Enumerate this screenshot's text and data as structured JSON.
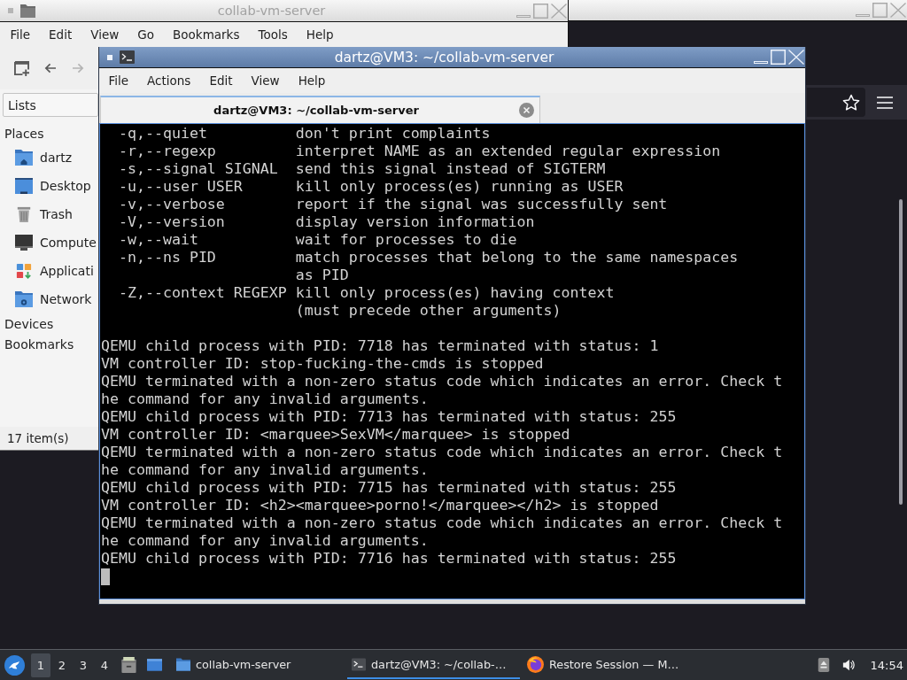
{
  "file_manager": {
    "active": false,
    "title": "collab-vm-server",
    "menu": [
      "File",
      "Edit",
      "View",
      "Go",
      "Bookmarks",
      "Tools",
      "Help"
    ],
    "toolbar": [
      {
        "kind": "new-tab",
        "disabled": false
      },
      {
        "kind": "back",
        "disabled": false
      },
      {
        "kind": "forward",
        "disabled": true
      }
    ],
    "sidebar": {
      "view": "Lists",
      "sections": [
        {
          "heading": "Places",
          "items": [
            {
              "kind": "home",
              "label": "dartz"
            },
            {
              "kind": "desktop",
              "label": "Desktop"
            },
            {
              "kind": "trash",
              "label": "Trash"
            },
            {
              "kind": "computer",
              "label": "Compute"
            },
            {
              "kind": "applications",
              "label": "Applicati"
            },
            {
              "kind": "network",
              "label": "Network"
            }
          ]
        },
        {
          "heading": "Devices"
        },
        {
          "heading": "Bookmarks"
        }
      ]
    },
    "status": "17 item(s)"
  },
  "terminal": {
    "active": true,
    "title": "dartz@VM3: ~/collab-vm-server",
    "menu": [
      "File",
      "Actions",
      "Edit",
      "View",
      "Help"
    ],
    "tabs": [
      {
        "label": "dartz@VM3: ~/collab-vm-server",
        "selected": true
      }
    ],
    "options": [
      {
        "flag": "-q,--quiet",
        "description": [
          "don't print complaints"
        ]
      },
      {
        "flag": "-r,--regexp",
        "description": [
          "interpret NAME as an extended regular expression"
        ]
      },
      {
        "flag": "-s,--signal SIGNAL",
        "description": [
          "send this signal instead of SIGTERM"
        ]
      },
      {
        "flag": "-u,--user USER",
        "description": [
          "kill only process(es) running as USER"
        ]
      },
      {
        "flag": "-v,--verbose",
        "description": [
          "report if the signal was successfully sent"
        ]
      },
      {
        "flag": "-V,--version",
        "description": [
          "display version information"
        ]
      },
      {
        "flag": "-w,--wait",
        "description": [
          "wait for processes to die"
        ]
      },
      {
        "flag": "-n,--ns PID",
        "description": [
          "match processes that belong to the same namespaces",
          "as PID"
        ]
      },
      {
        "flag": "-Z,--context REGEXP",
        "description": [
          "kill only process(es) having context",
          "(must precede other arguments)"
        ]
      }
    ],
    "log": [
      "QEMU child process with PID: 7718 has terminated with status: 1",
      "VM controller ID: stop-fucking-the-cmds is stopped",
      "QEMU terminated with a non-zero status code which indicates an error. Check t",
      "he command for any invalid arguments.",
      "QEMU child process with PID: 7713 has terminated with status: 255",
      "VM controller ID: <marquee>SexVM</marquee> is stopped",
      "QEMU terminated with a non-zero status code which indicates an error. Check t",
      "he command for any invalid arguments.",
      "QEMU child process with PID: 7715 has terminated with status: 255",
      "VM controller ID: <h2><marquee>porno!</marquee></h2> is stopped",
      "QEMU terminated with a non-zero status code which indicates an error. Check t",
      "he command for any invalid arguments.",
      "QEMU child process with PID: 7716 has terminated with status: 255"
    ]
  },
  "taskbar": {
    "workspaces": [
      {
        "label": "1",
        "selected": true
      },
      {
        "label": "2",
        "selected": false
      },
      {
        "label": "3",
        "selected": false
      },
      {
        "label": "4",
        "selected": false
      }
    ],
    "launchers": [
      {
        "kind": "drawer"
      },
      {
        "kind": "desktop"
      }
    ],
    "tasks": [
      {
        "kind": "folder",
        "label": "collab-vm-server",
        "selected": false
      },
      {
        "kind": "terminal",
        "label": "dartz@VM3: ~/collab-…",
        "selected": true
      },
      {
        "kind": "browser",
        "label": "Restore Session — M…",
        "selected": false
      }
    ],
    "tray": [
      {
        "kind": "eject"
      },
      {
        "kind": "volume"
      }
    ],
    "clock": "14:54"
  }
}
